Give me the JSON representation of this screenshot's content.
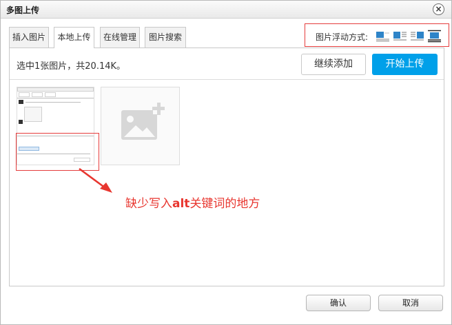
{
  "window": {
    "title": "多图上传"
  },
  "tabs": [
    {
      "label": "插入图片"
    },
    {
      "label": "本地上传"
    },
    {
      "label": "在线管理"
    },
    {
      "label": "图片搜索"
    }
  ],
  "float": {
    "label": "图片浮动方式:",
    "options": [
      "none-icon",
      "left-icon",
      "right-icon",
      "center-icon"
    ],
    "selected": "center"
  },
  "status": {
    "text": "选中1张图片，共20.14K。"
  },
  "buttons": {
    "continue": "继续添加",
    "start": "开始上传",
    "ok": "确认",
    "cancel": "取消"
  },
  "annotation": {
    "prefix": "缺少写入",
    "keyword": "alt",
    "suffix": "关键词的地方"
  },
  "colors": {
    "accent": "#00a0e9",
    "annotation": "#e8362f",
    "border": "#c8c8c8"
  }
}
